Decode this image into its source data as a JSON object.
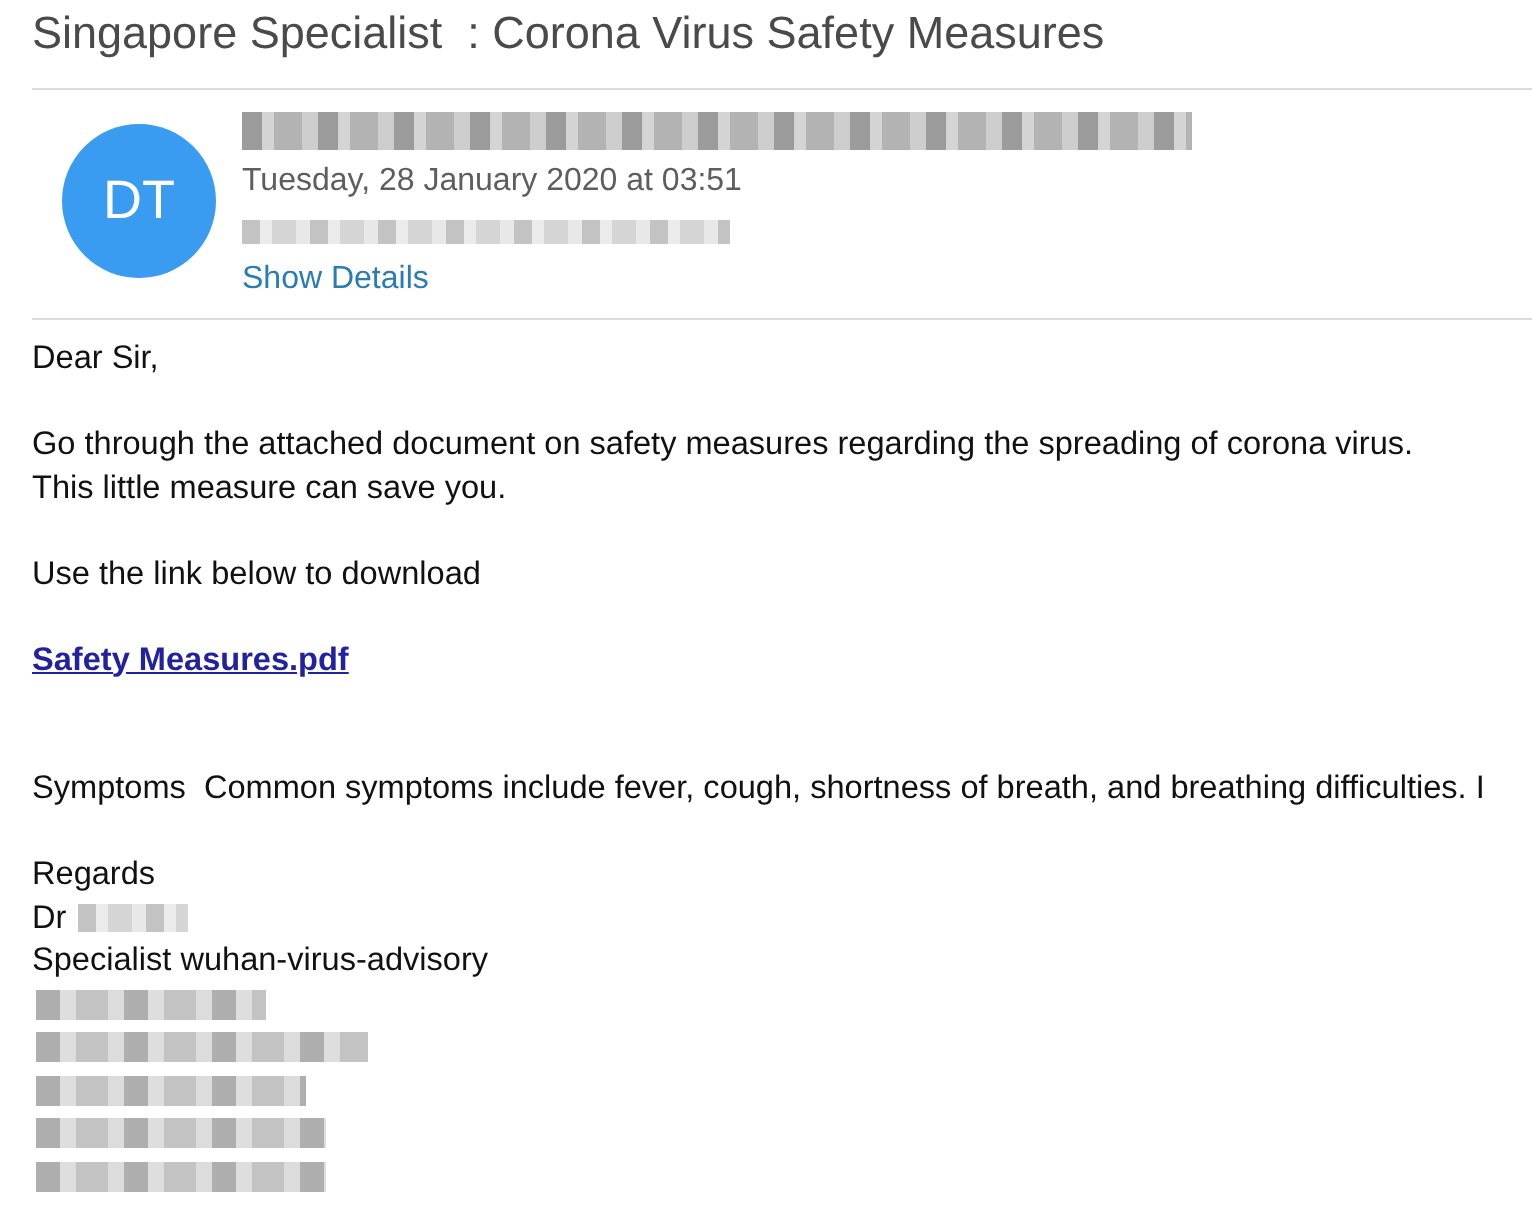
{
  "subject": "Singapore Specialist  : Corona Virus Safety Measures",
  "header": {
    "avatar_initials": "DT",
    "date": "Tuesday, 28 January 2020 at 03:51",
    "show_details": "Show Details"
  },
  "body": [
    {
      "kind": "paragraph",
      "lines": [
        "Dear Sir,"
      ]
    },
    {
      "kind": "paragraph",
      "lines": [
        "Go through the attached document on safety measures regarding the spreading of corona virus.",
        "This little measure can save you."
      ]
    },
    {
      "kind": "paragraph",
      "lines": [
        "Use the link below to download"
      ]
    },
    {
      "kind": "link",
      "text": "Safety Measures.pdf"
    },
    {
      "kind": "paragraph",
      "lines": [
        "Symptoms  Common symptoms include fever, cough, shortness of breath, and breathing difficulties. I"
      ]
    }
  ],
  "signature": {
    "closing": "Regards",
    "title": "Dr",
    "role": "Specialist wuhan-virus-advisory"
  }
}
